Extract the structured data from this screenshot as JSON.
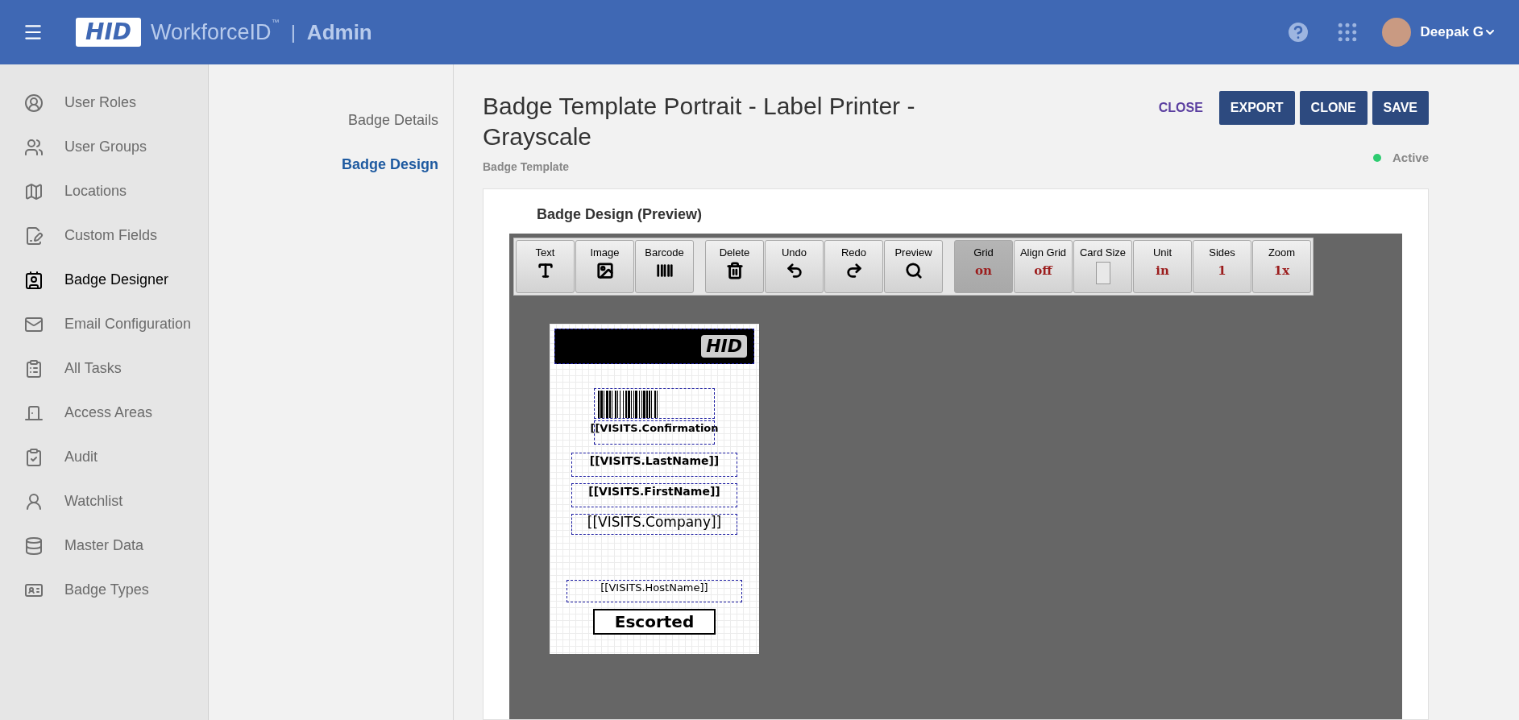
{
  "header": {
    "brand": "HID",
    "product": "WorkforceID",
    "trademark": "™",
    "separator": "|",
    "section": "Admin",
    "user": "Deepak G"
  },
  "sidebar": {
    "items": [
      {
        "label": "User Roles",
        "selected": false
      },
      {
        "label": "User Groups",
        "selected": false
      },
      {
        "label": "Locations",
        "selected": false
      },
      {
        "label": "Custom Fields",
        "selected": false
      },
      {
        "label": "Badge Designer",
        "selected": true
      },
      {
        "label": "Email Configuration",
        "selected": false
      },
      {
        "label": "All Tasks",
        "selected": false
      },
      {
        "label": "Access Areas",
        "selected": false
      },
      {
        "label": "Audit",
        "selected": false
      },
      {
        "label": "Watchlist",
        "selected": false
      },
      {
        "label": "Master Data",
        "selected": false
      },
      {
        "label": "Badge Types",
        "selected": false
      }
    ]
  },
  "subnav": {
    "items": [
      {
        "label": "Badge Details",
        "selected": false
      },
      {
        "label": "Badge Design",
        "selected": true
      }
    ]
  },
  "page": {
    "title": "Badge Template Portrait - Label Printer - Grayscale",
    "subtitle": "Badge Template",
    "status": {
      "label": "Active",
      "color": "#2ecc71"
    },
    "actions": [
      {
        "label": "CLOSE",
        "kind": "link"
      },
      {
        "label": "EXPORT",
        "kind": "primary"
      },
      {
        "label": "CLONE",
        "kind": "primary"
      },
      {
        "label": "SAVE",
        "kind": "primary"
      }
    ]
  },
  "card": {
    "title": "Badge Design (Preview)"
  },
  "toolbar": {
    "groups": [
      [
        {
          "label": "Text",
          "kind": "icon",
          "selected": false
        },
        {
          "label": "Image",
          "kind": "icon",
          "selected": false
        },
        {
          "label": "Barcode",
          "kind": "icon",
          "selected": false
        }
      ],
      [
        {
          "label": "Delete",
          "kind": "icon",
          "selected": false
        },
        {
          "label": "Undo",
          "kind": "icon",
          "selected": false
        },
        {
          "label": "Redo",
          "kind": "icon",
          "selected": false
        },
        {
          "label": "Preview",
          "kind": "icon",
          "selected": false
        }
      ],
      [
        {
          "label": "Grid",
          "kind": "value",
          "value": "on",
          "selected": true
        },
        {
          "label": "Align Grid",
          "kind": "value",
          "value": "off",
          "selected": false
        },
        {
          "label": "Card Size",
          "kind": "swatch",
          "selected": false
        },
        {
          "label": "Unit",
          "kind": "value",
          "value": "in",
          "selected": false
        },
        {
          "label": "Sides",
          "kind": "value",
          "value": "1",
          "selected": false
        },
        {
          "label": "Zoom",
          "kind": "value",
          "value": "1x",
          "selected": false
        }
      ]
    ]
  },
  "badge": {
    "elements": [
      {
        "kind": "logo",
        "text": "HID"
      },
      {
        "kind": "barcode"
      },
      {
        "kind": "field",
        "text": "[[VISITS.Confirmation",
        "bold": true
      },
      {
        "kind": "field",
        "text": "[[VISITS.LastName]]",
        "bold": true
      },
      {
        "kind": "field",
        "text": "[[VISITS.FirstName]]",
        "bold": true
      },
      {
        "kind": "field",
        "text": "[[VISITS.Company]]",
        "bold": false
      },
      {
        "kind": "spacer"
      },
      {
        "kind": "field",
        "text": "[[VISITS.HostName]]",
        "bold": false
      },
      {
        "kind": "stamp",
        "text": "Escorted"
      }
    ]
  }
}
